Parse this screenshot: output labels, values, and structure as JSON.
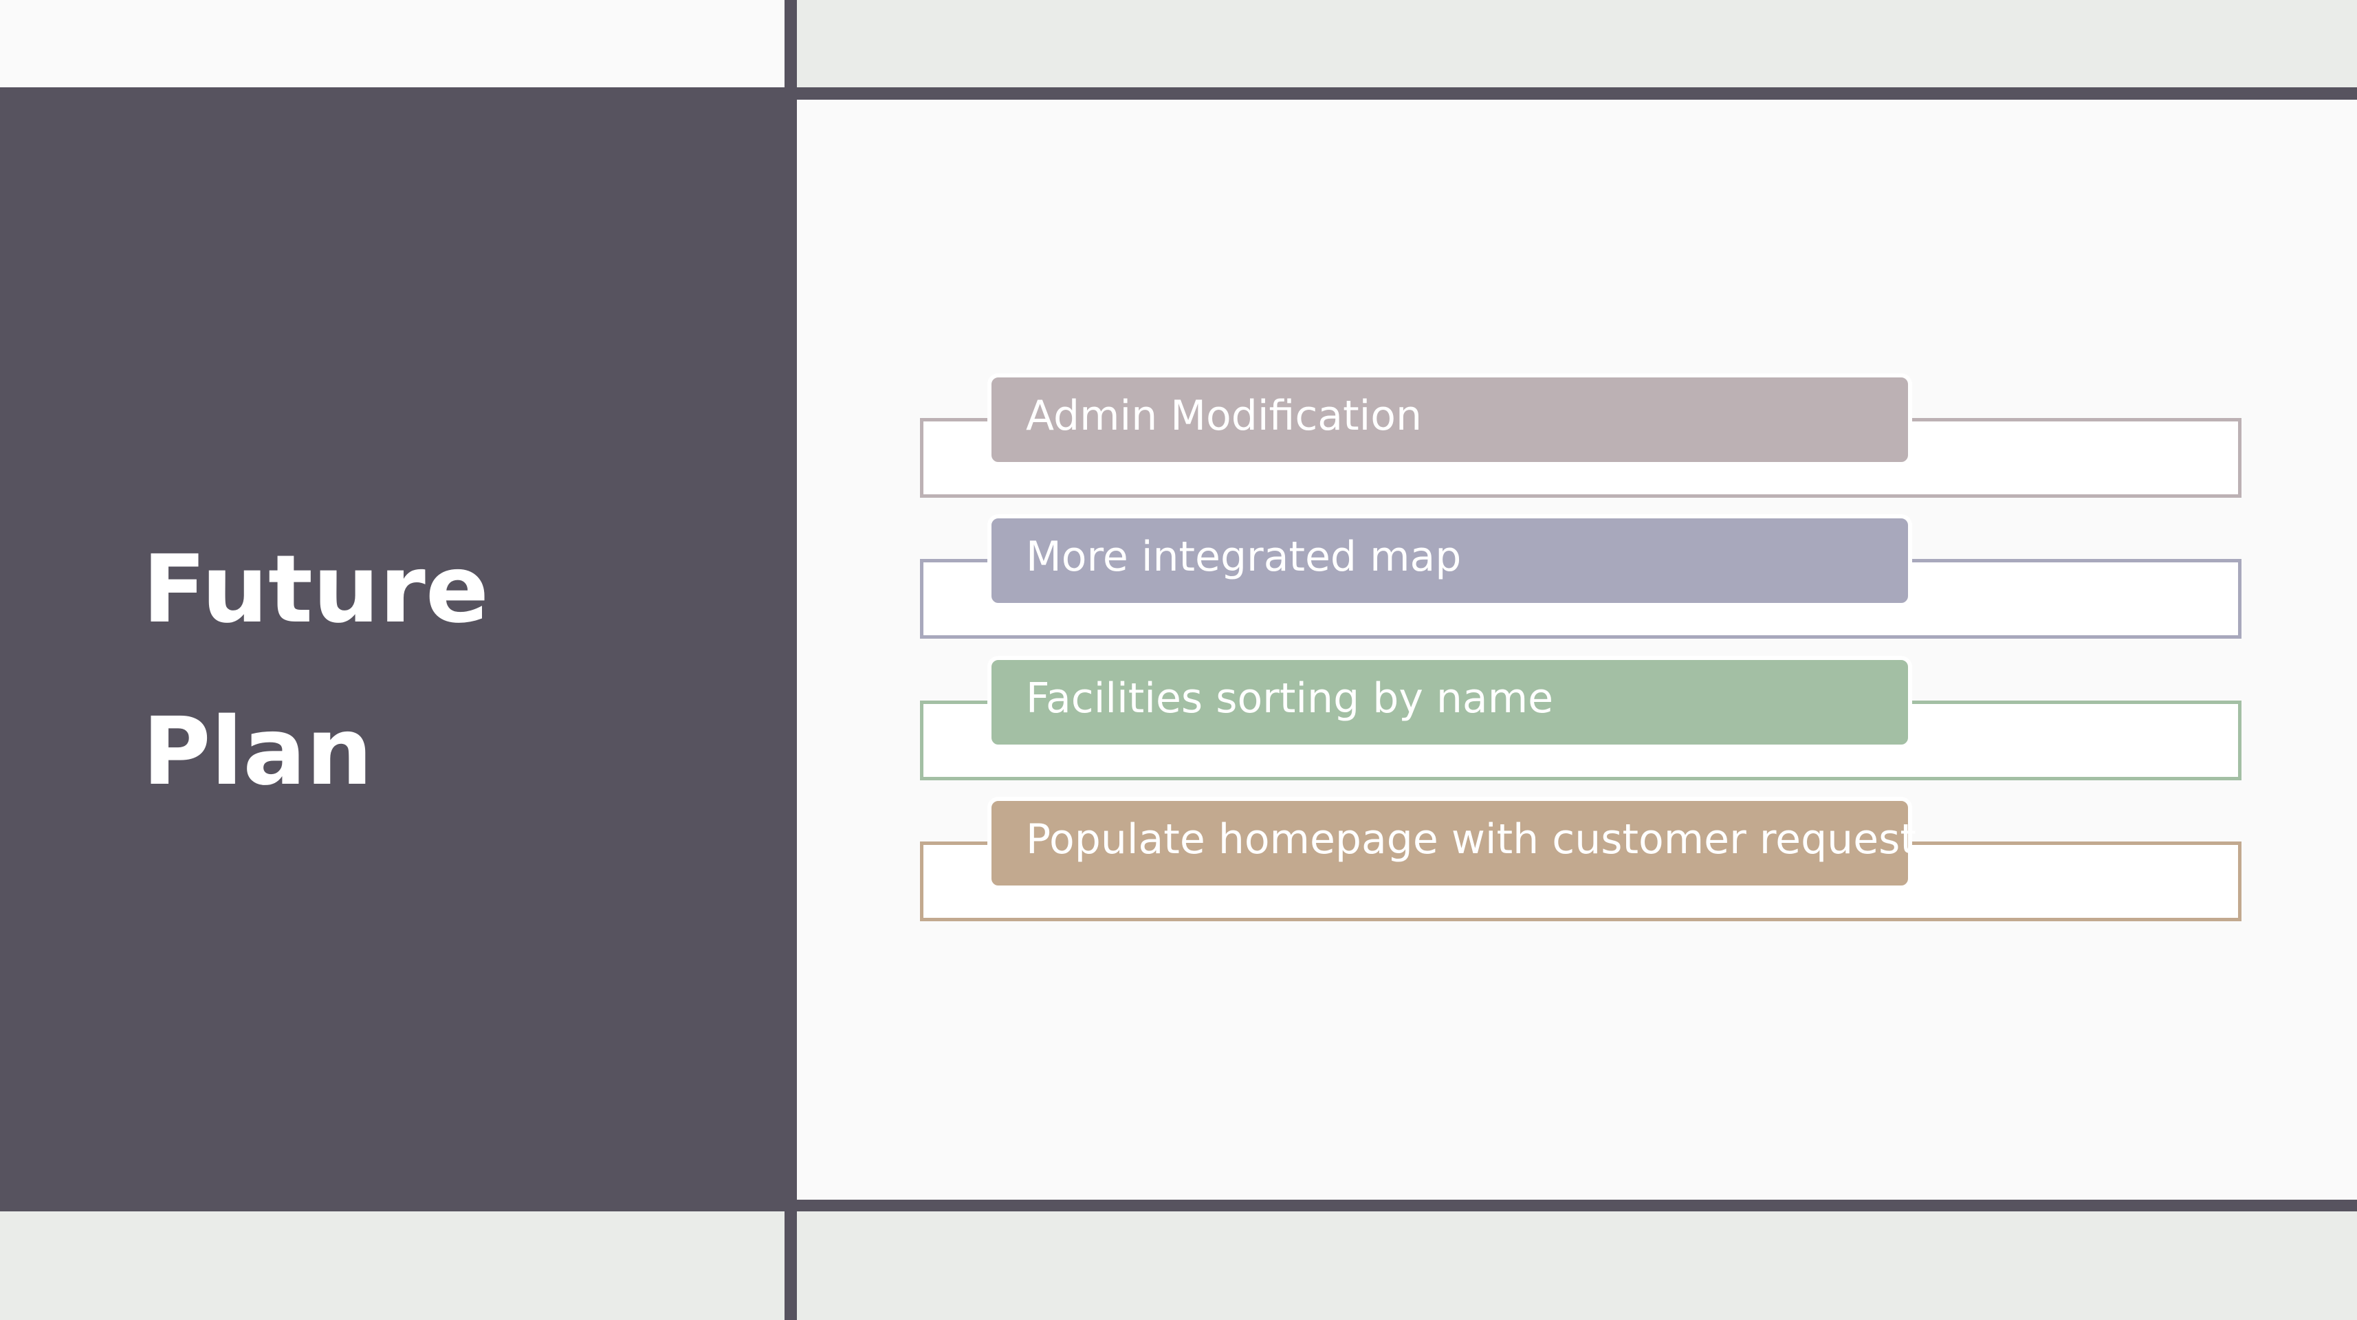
{
  "title": {
    "line1": "Future",
    "line2": "Plan"
  },
  "items": [
    {
      "label": "Admin Modification",
      "color": "#bcb1b4"
    },
    {
      "label": "More integrated map",
      "color": "#a8a8bc"
    },
    {
      "label": "Facilities sorting by name",
      "color": "#a3bfa4"
    },
    {
      "label": "Populate homepage with customer request",
      "color": "#c2a98f"
    }
  ],
  "colors": {
    "panel": "#57535f",
    "background": "#fafafa",
    "band": "#eaece9",
    "text": "#ffffff"
  }
}
